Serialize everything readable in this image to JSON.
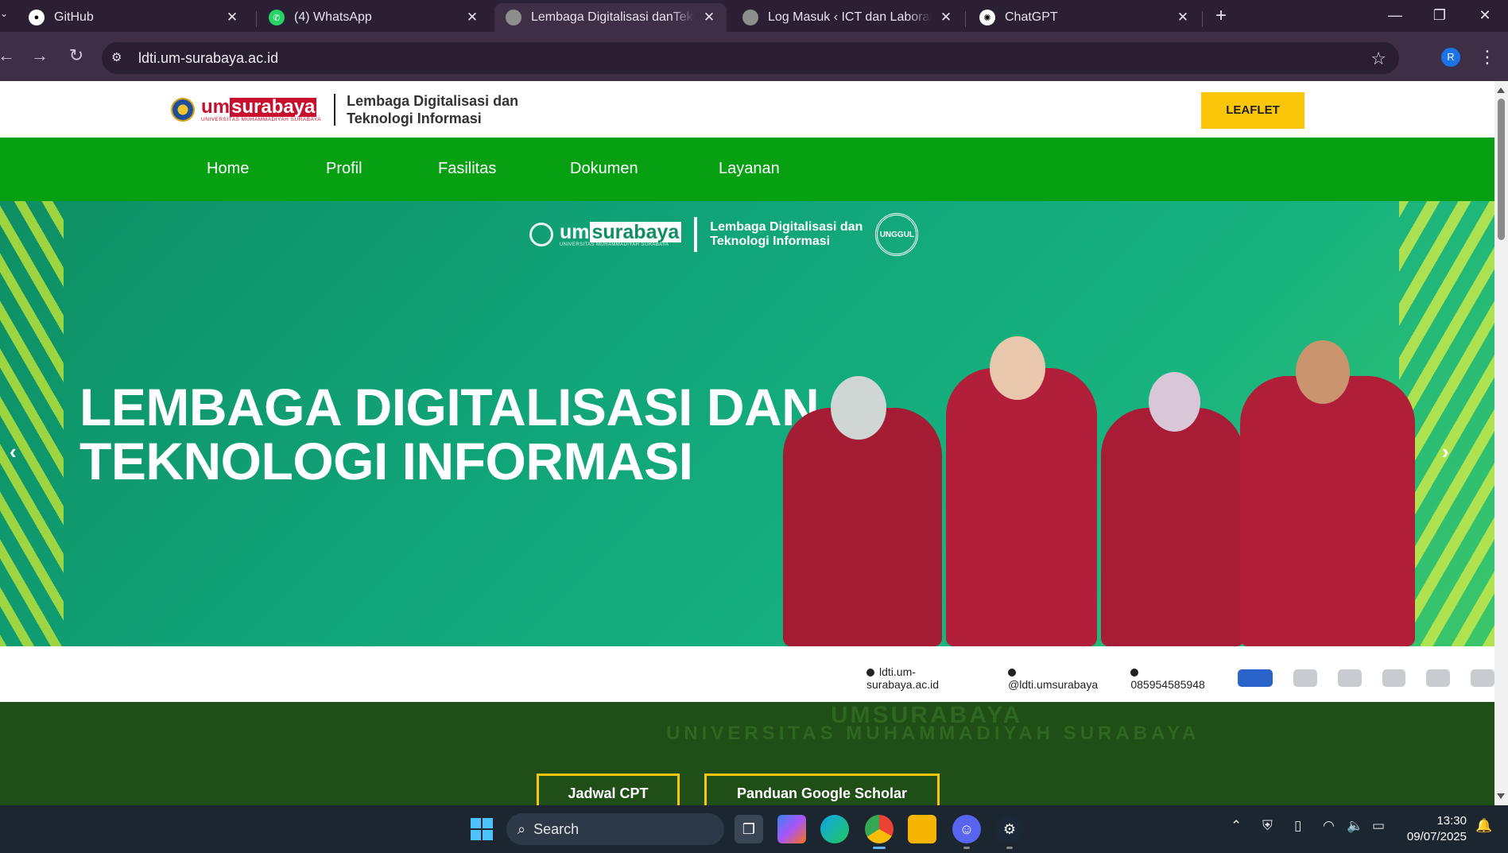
{
  "tabs": [
    {
      "title": "GitHub",
      "icon": "github-icon"
    },
    {
      "title": "(4) WhatsApp",
      "icon": "whatsapp-icon"
    },
    {
      "title": "Lembaga Digitalisasi danTeknologi",
      "icon": "umsurabaya-icon",
      "active": true
    },
    {
      "title": "Log Masuk ‹ ICT dan Laboratorium",
      "icon": "umsurabaya-icon"
    },
    {
      "title": "ChatGPT",
      "icon": "chatgpt-icon"
    }
  ],
  "toolbar": {
    "url": "ldti.um-surabaya.ac.id",
    "profile_initial": "R"
  },
  "site": {
    "logo_um": "um",
    "logo_surabaya": "surabaya",
    "logo_subtitle": "UNIVERSITAS MUHAMMADIYAH SURABAYA",
    "unit_line1": "Lembaga Digitalisasi dan",
    "unit_line2": "Teknologi Informasi",
    "leaflet_label": "LEAFLET",
    "nav": [
      "Home",
      "Profil",
      "Fasilitas",
      "Dokumen",
      "Layanan"
    ]
  },
  "hero": {
    "brand_um": "um",
    "brand_surabaya": "surabaya",
    "brand_subtitle": "UNIVERSITAS MUHAMMADIYAH SURABAYA",
    "unit_line1": "Lembaga Digitalisasi dan",
    "unit_line2": "Teknologi Informasi",
    "badge": "UNGGUL",
    "title_line1": "LEMBAGA DIGITALISASI DAN",
    "title_line2": "TEKNOLOGI INFORMASI",
    "footer_website": "ldti.um-surabaya.ac.id",
    "footer_instagram": "@ldti.umsurabaya",
    "footer_phone": "085954585948"
  },
  "lower": {
    "ghost_title": "UMSURABAYA",
    "ghost_subtitle": "UNIVERSITAS MUHAMMADIYAH SURABAYA",
    "btn1": "Jadwal CPT",
    "btn2": "Panduan Google Scholar"
  },
  "taskbar": {
    "search_placeholder": "Search",
    "time": "13:30",
    "date": "09/07/2025"
  },
  "colors": {
    "nav_green": "#06a012",
    "leaflet_yellow": "#fbc60a",
    "brand_red": "#c8102e",
    "hero_green": "#11a57a"
  }
}
